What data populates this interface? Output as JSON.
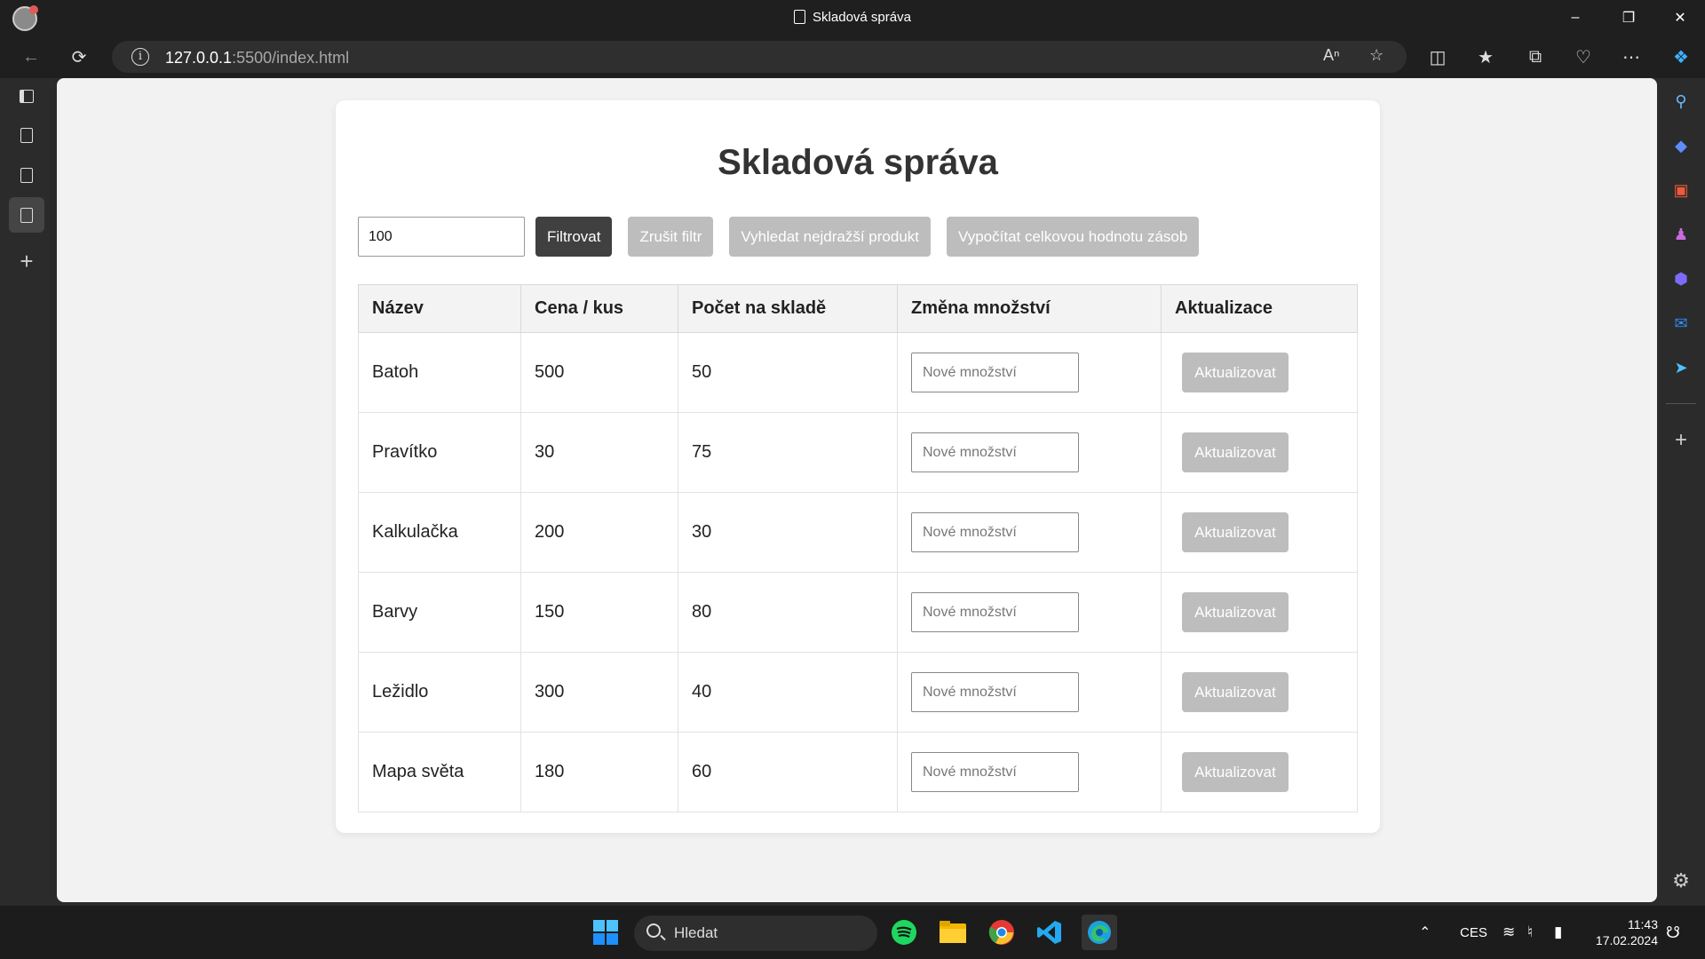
{
  "browser": {
    "window_title": "Skladová správa",
    "url_host": "127.0.0.1",
    "url_rest": ":5500/index.html"
  },
  "page": {
    "title": "Skladová správa",
    "filter": {
      "value": "100",
      "filter_label": "Filtrovat",
      "clear_label": "Zrušit filtr",
      "most_expensive_label": "Vyhledat nejdražší produkt",
      "total_value_label": "Vypočítat celkovou hodnotu zásob"
    },
    "table": {
      "headers": [
        "Název",
        "Cena / kus",
        "Počet na skladě",
        "Změna množství",
        "Aktualizace"
      ],
      "rows": [
        {
          "name": "Batoh",
          "price": "500",
          "stock": "50"
        },
        {
          "name": "Pravítko",
          "price": "30",
          "stock": "75"
        },
        {
          "name": "Kalkulačka",
          "price": "200",
          "stock": "30"
        },
        {
          "name": "Barvy",
          "price": "150",
          "stock": "80"
        },
        {
          "name": "Ležidlo",
          "price": "300",
          "stock": "40"
        },
        {
          "name": "Mapa světa",
          "price": "180",
          "stock": "60"
        }
      ],
      "qty_placeholder": "Nové množství",
      "update_label": "Aktualizovat"
    }
  },
  "taskbar": {
    "search_label": "Hledat",
    "language": "CES",
    "time": "11:43",
    "date": "17.02.2024"
  },
  "colors": {
    "title_text": "#333333",
    "dark_button": "#404040",
    "disabled_button": "#bdbdbd"
  }
}
